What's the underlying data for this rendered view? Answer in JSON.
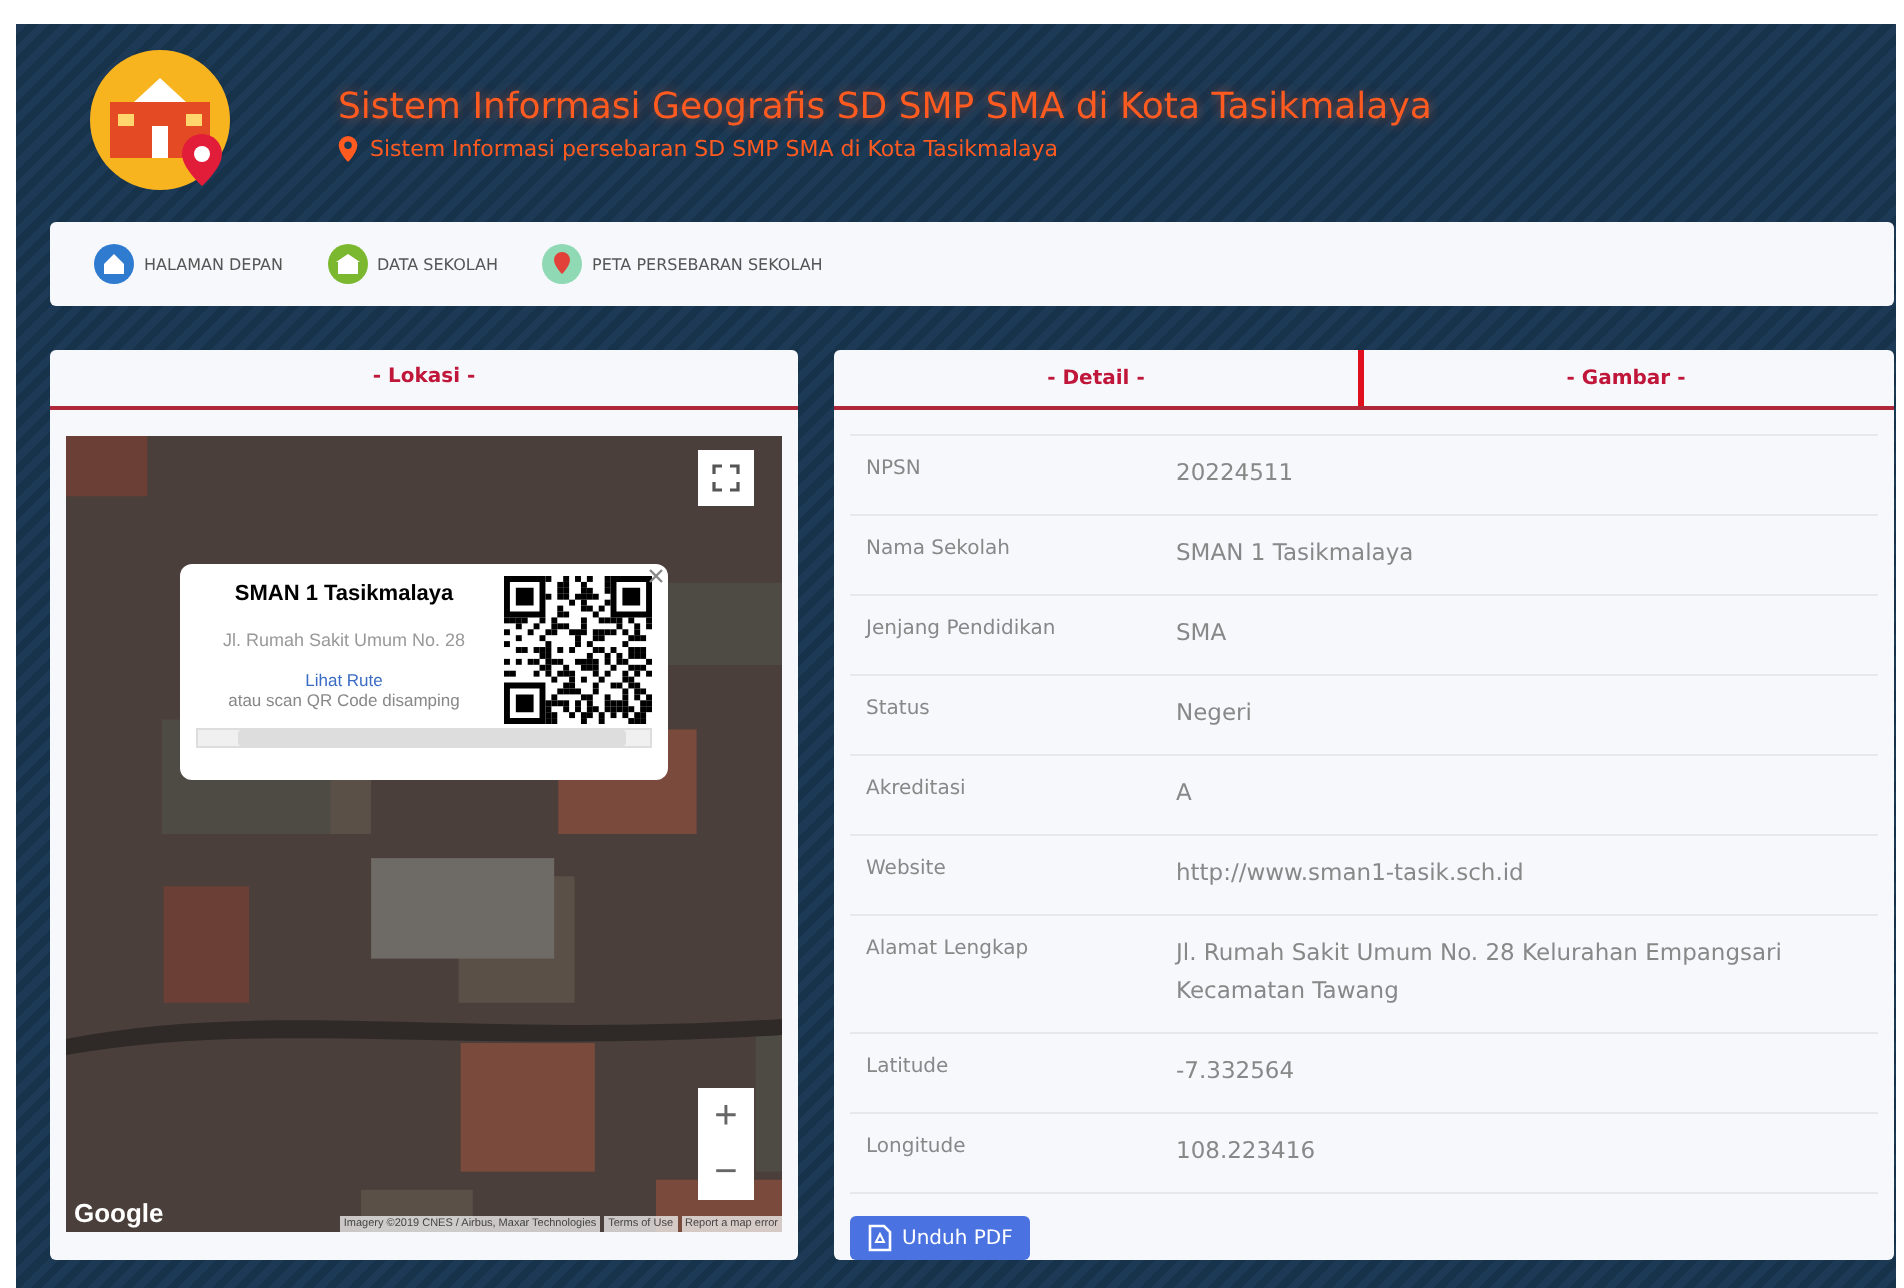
{
  "header": {
    "title": "Sistem Informasi Geografis SD SMP SMA di Kota Tasikmalaya",
    "subtitle": "Sistem Informasi persebaran SD SMP SMA di Kota Tasikmalaya"
  },
  "nav": [
    {
      "label": "HALAMAN DEPAN",
      "kind": "home"
    },
    {
      "label": "DATA SEKOLAH",
      "kind": "school"
    },
    {
      "label": "PETA PERSEBARAN SEKOLAH",
      "kind": "map"
    }
  ],
  "location_panel": {
    "title": "- Lokasi -",
    "map": {
      "kind": "picture",
      "popup": {
        "name": "SMAN 1 Tasikmalaya",
        "address": "Jl. Rumah Sakit Umum No. 28",
        "route_link": "Lihat Rute",
        "hint": "atau scan QR Code disamping"
      },
      "logo": "Google",
      "attribution": "Imagery ©2019 CNES / Airbus, Maxar Technologies",
      "terms": "Terms of Use",
      "report": "Report a map error",
      "zoom_in": "+",
      "zoom_out": "−"
    }
  },
  "detail_panel": {
    "tabs": [
      {
        "label": "- Detail -",
        "selected": true
      },
      {
        "label": "- Gambar -",
        "selected": false
      }
    ],
    "rows": [
      {
        "label": "NPSN",
        "value": "20224511"
      },
      {
        "label": "Nama Sekolah",
        "value": "SMAN 1 Tasikmalaya"
      },
      {
        "label": "Jenjang Pendidikan",
        "value": "SMA"
      },
      {
        "label": "Status",
        "value": "Negeri"
      },
      {
        "label": "Akreditasi",
        "value": "A"
      },
      {
        "label": "Website",
        "value": "http://www.sman1-tasik.sch.id"
      },
      {
        "label": "Alamat Lengkap",
        "value": "Jl. Rumah Sakit Umum No. 28 Kelurahan Empangsari Kecamatan Tawang"
      },
      {
        "label": "Latitude",
        "value": "-7.332564"
      },
      {
        "label": "Longitude",
        "value": "108.223416"
      }
    ],
    "button": "Unduh PDF"
  }
}
